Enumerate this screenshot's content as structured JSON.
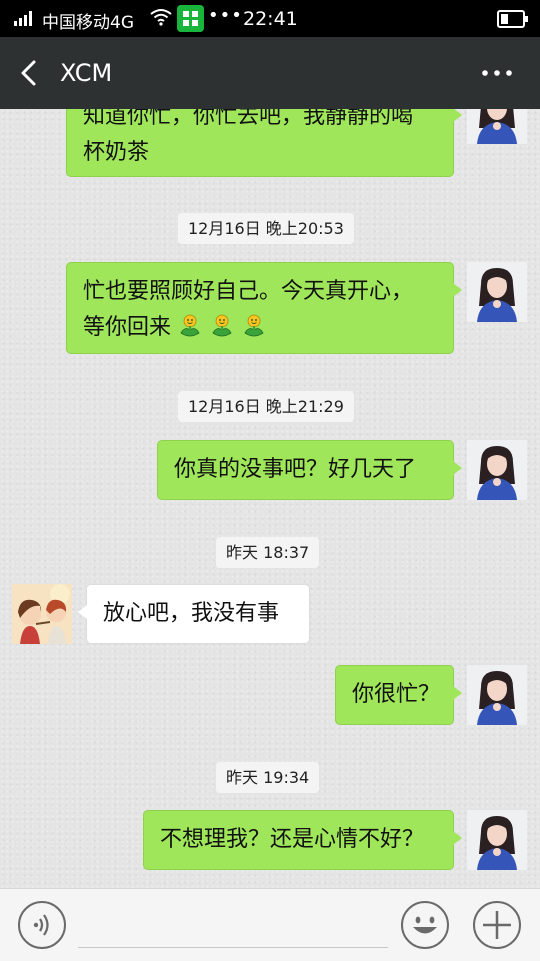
{
  "status_bar": {
    "carrier": "中国移动4G",
    "dots": "•••",
    "time": "22:41"
  },
  "header": {
    "title": "XCM"
  },
  "messages": [
    {
      "text_line1": "知道你忙，你忙去吧，我静静的喝",
      "text_line2": "杯奶茶"
    },
    {
      "text_line1": "忙也要照顾好自己。今天真开心，",
      "text_line2": "等你回来"
    },
    {
      "text": "你真的没事吧？好几天了"
    },
    {
      "text": "放心吧，我没有事"
    },
    {
      "text": "你很忙？"
    },
    {
      "text": "不想理我？还是心情不好？"
    }
  ],
  "timestamps": [
    "12月16日 晚上20:53",
    "12月16日 晚上21:29",
    "昨天 18:37",
    "昨天 19:34"
  ],
  "icons": {
    "back": "back-arrow-icon",
    "more": "more-icon",
    "voice": "voice-icon",
    "emoji": "emoji-face-icon",
    "plus": "plus-icon",
    "inline_emoji": "smiling-flower-icon"
  },
  "colors": {
    "my_bubble": "#9fe65a",
    "other_bubble": "#ffffff",
    "header_bg": "#2e3132"
  }
}
